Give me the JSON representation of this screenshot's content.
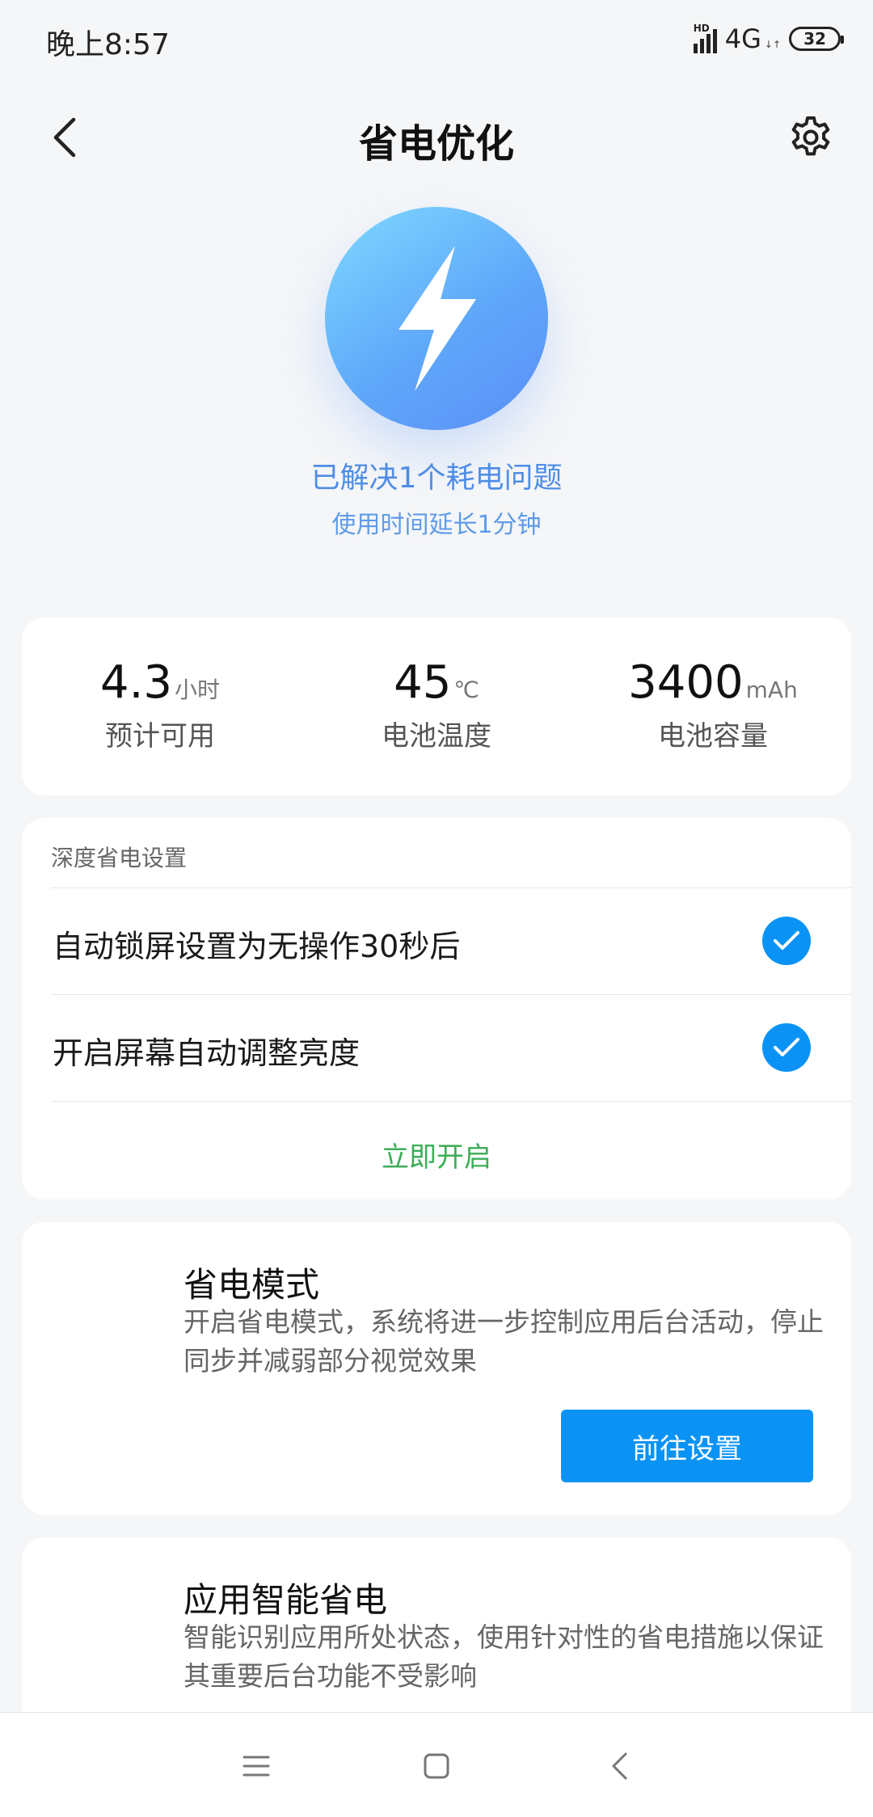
{
  "status_bar": {
    "time": "晚上8:57",
    "hd_label": "HD",
    "network": "4G",
    "network_arrows": "↓↑",
    "battery_level": "32"
  },
  "header": {
    "title": "省电优化"
  },
  "hero": {
    "icon": "lightning-icon",
    "line1": "已解决1个耗电问题",
    "line2": "使用时间延长1分钟"
  },
  "stats": [
    {
      "value": "4.3",
      "unit": "小时",
      "label": "预计可用"
    },
    {
      "value": "45",
      "unit": "℃",
      "label": "电池温度"
    },
    {
      "value": "3400",
      "unit": "mAh",
      "label": "电池容量"
    }
  ],
  "deep_settings": {
    "header": "深度省电设置",
    "items": [
      {
        "label": "自动锁屏设置为无操作30秒后",
        "checked": true
      },
      {
        "label": "开启屏幕自动调整亮度",
        "checked": true
      }
    ],
    "action": "立即开启"
  },
  "power_mode": {
    "title": "省电模式",
    "description": "开启省电模式，系统将进一步控制应用后台活动，停止同步并减弱部分视觉效果",
    "button": "前往设置"
  },
  "smart_saving": {
    "title": "应用智能省电",
    "description": "智能识别应用所处状态，使用针对性的省电措施以保证其重要后台功能不受影响"
  },
  "colors": {
    "accent": "#0a93f5",
    "hero_text": "#4f8de6",
    "action_green": "#3cad57"
  }
}
